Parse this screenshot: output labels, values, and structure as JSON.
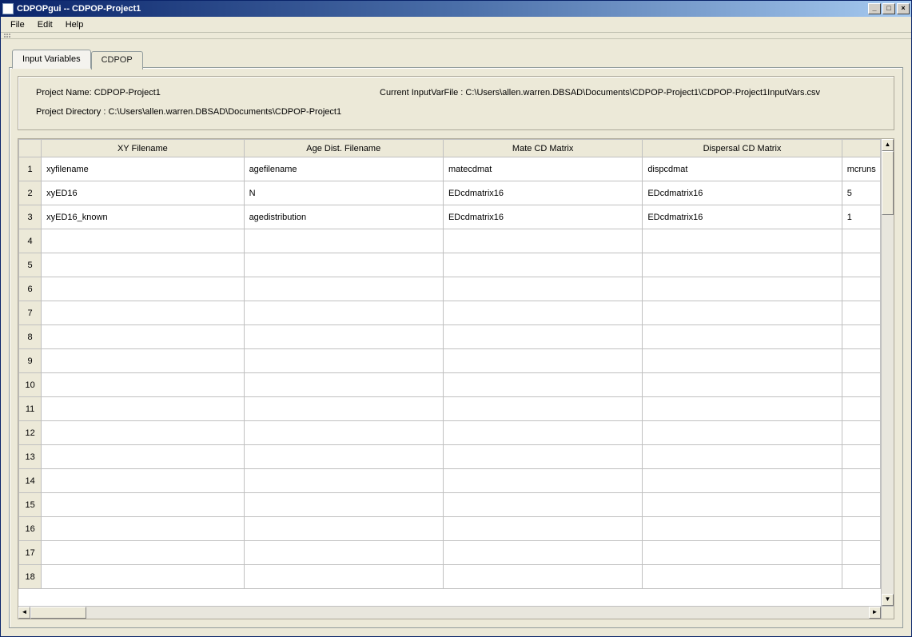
{
  "window": {
    "title": "CDPOPgui -- CDPOP-Project1"
  },
  "menu": {
    "file": "File",
    "edit": "Edit",
    "help": "Help"
  },
  "tabs": {
    "inputvars": "Input Variables",
    "cdpop": "CDPOP"
  },
  "info": {
    "project_name_label": "Project Name: CDPOP-Project1",
    "inputvar_label": "Current InputVarFile : C:\\Users\\allen.warren.DBSAD\\Documents\\CDPOP-Project1\\CDPOP-Project1InputVars.csv",
    "project_dir_label": "Project Directory : C:\\Users\\allen.warren.DBSAD\\Documents\\CDPOP-Project1"
  },
  "grid": {
    "headers": {
      "c1": "XY Filename",
      "c2": "Age Dist. Filename",
      "c3": "Mate CD Matrix",
      "c4": "Dispersal CD Matrix",
      "c5": ""
    },
    "rows": [
      {
        "n": "1",
        "c1": "xyfilename",
        "c2": "agefilename",
        "c3": "matecdmat",
        "c4": "dispcdmat",
        "c5": "mcruns"
      },
      {
        "n": "2",
        "c1": "xyED16",
        "c2": "N",
        "c3": "EDcdmatrix16",
        "c4": "EDcdmatrix16",
        "c5": "5"
      },
      {
        "n": "3",
        "c1": "xyED16_known",
        "c2": "agedistribution",
        "c3": "EDcdmatrix16",
        "c4": "EDcdmatrix16",
        "c5": "1"
      },
      {
        "n": "4",
        "c1": "",
        "c2": "",
        "c3": "",
        "c4": "",
        "c5": ""
      },
      {
        "n": "5",
        "c1": "",
        "c2": "",
        "c3": "",
        "c4": "",
        "c5": ""
      },
      {
        "n": "6",
        "c1": "",
        "c2": "",
        "c3": "",
        "c4": "",
        "c5": ""
      },
      {
        "n": "7",
        "c1": "",
        "c2": "",
        "c3": "",
        "c4": "",
        "c5": ""
      },
      {
        "n": "8",
        "c1": "",
        "c2": "",
        "c3": "",
        "c4": "",
        "c5": ""
      },
      {
        "n": "9",
        "c1": "",
        "c2": "",
        "c3": "",
        "c4": "",
        "c5": ""
      },
      {
        "n": "10",
        "c1": "",
        "c2": "",
        "c3": "",
        "c4": "",
        "c5": ""
      },
      {
        "n": "11",
        "c1": "",
        "c2": "",
        "c3": "",
        "c4": "",
        "c5": ""
      },
      {
        "n": "12",
        "c1": "",
        "c2": "",
        "c3": "",
        "c4": "",
        "c5": ""
      },
      {
        "n": "13",
        "c1": "",
        "c2": "",
        "c3": "",
        "c4": "",
        "c5": ""
      },
      {
        "n": "14",
        "c1": "",
        "c2": "",
        "c3": "",
        "c4": "",
        "c5": ""
      },
      {
        "n": "15",
        "c1": "",
        "c2": "",
        "c3": "",
        "c4": "",
        "c5": ""
      },
      {
        "n": "16",
        "c1": "",
        "c2": "",
        "c3": "",
        "c4": "",
        "c5": ""
      },
      {
        "n": "17",
        "c1": "",
        "c2": "",
        "c3": "",
        "c4": "",
        "c5": ""
      },
      {
        "n": "18",
        "c1": "",
        "c2": "",
        "c3": "",
        "c4": "",
        "c5": ""
      }
    ]
  }
}
